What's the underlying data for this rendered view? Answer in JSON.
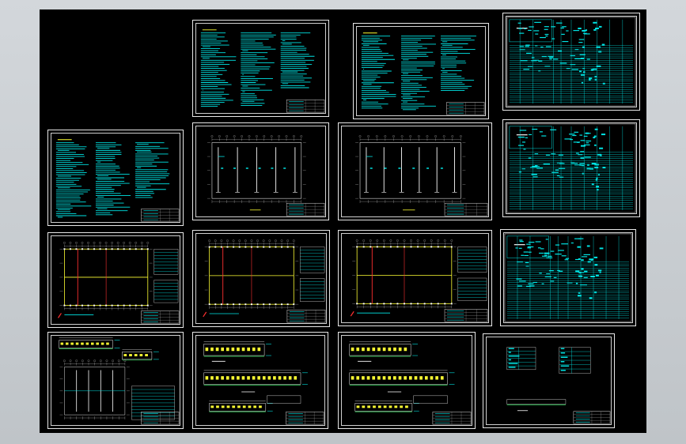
{
  "viewer": {
    "background_color": "#000000",
    "frame_color": "#e8e8e8",
    "accent_cyan": "#00e5e5",
    "accent_yellow": "#ffff33",
    "accent_red": "#ff3030",
    "accent_green": "#33ff66"
  },
  "sheets": [
    {
      "id": "notes-1",
      "kind": "notes"
    },
    {
      "id": "notes-2",
      "kind": "notes"
    },
    {
      "id": "schedule-1",
      "kind": "schedule"
    },
    {
      "id": "notes-3",
      "kind": "notes"
    },
    {
      "id": "plan-1",
      "kind": "plan-columns"
    },
    {
      "id": "plan-2",
      "kind": "plan-columns"
    },
    {
      "id": "schedule-2",
      "kind": "schedule"
    },
    {
      "id": "plan-3",
      "kind": "plan-red"
    },
    {
      "id": "plan-4",
      "kind": "plan-red"
    },
    {
      "id": "plan-5",
      "kind": "plan-red"
    },
    {
      "id": "schedule-3",
      "kind": "schedule"
    },
    {
      "id": "elev-1",
      "kind": "elevation-mixed"
    },
    {
      "id": "elev-2",
      "kind": "elevation"
    },
    {
      "id": "elev-3",
      "kind": "elevation"
    },
    {
      "id": "elev-4",
      "kind": "elevation-tables"
    }
  ]
}
